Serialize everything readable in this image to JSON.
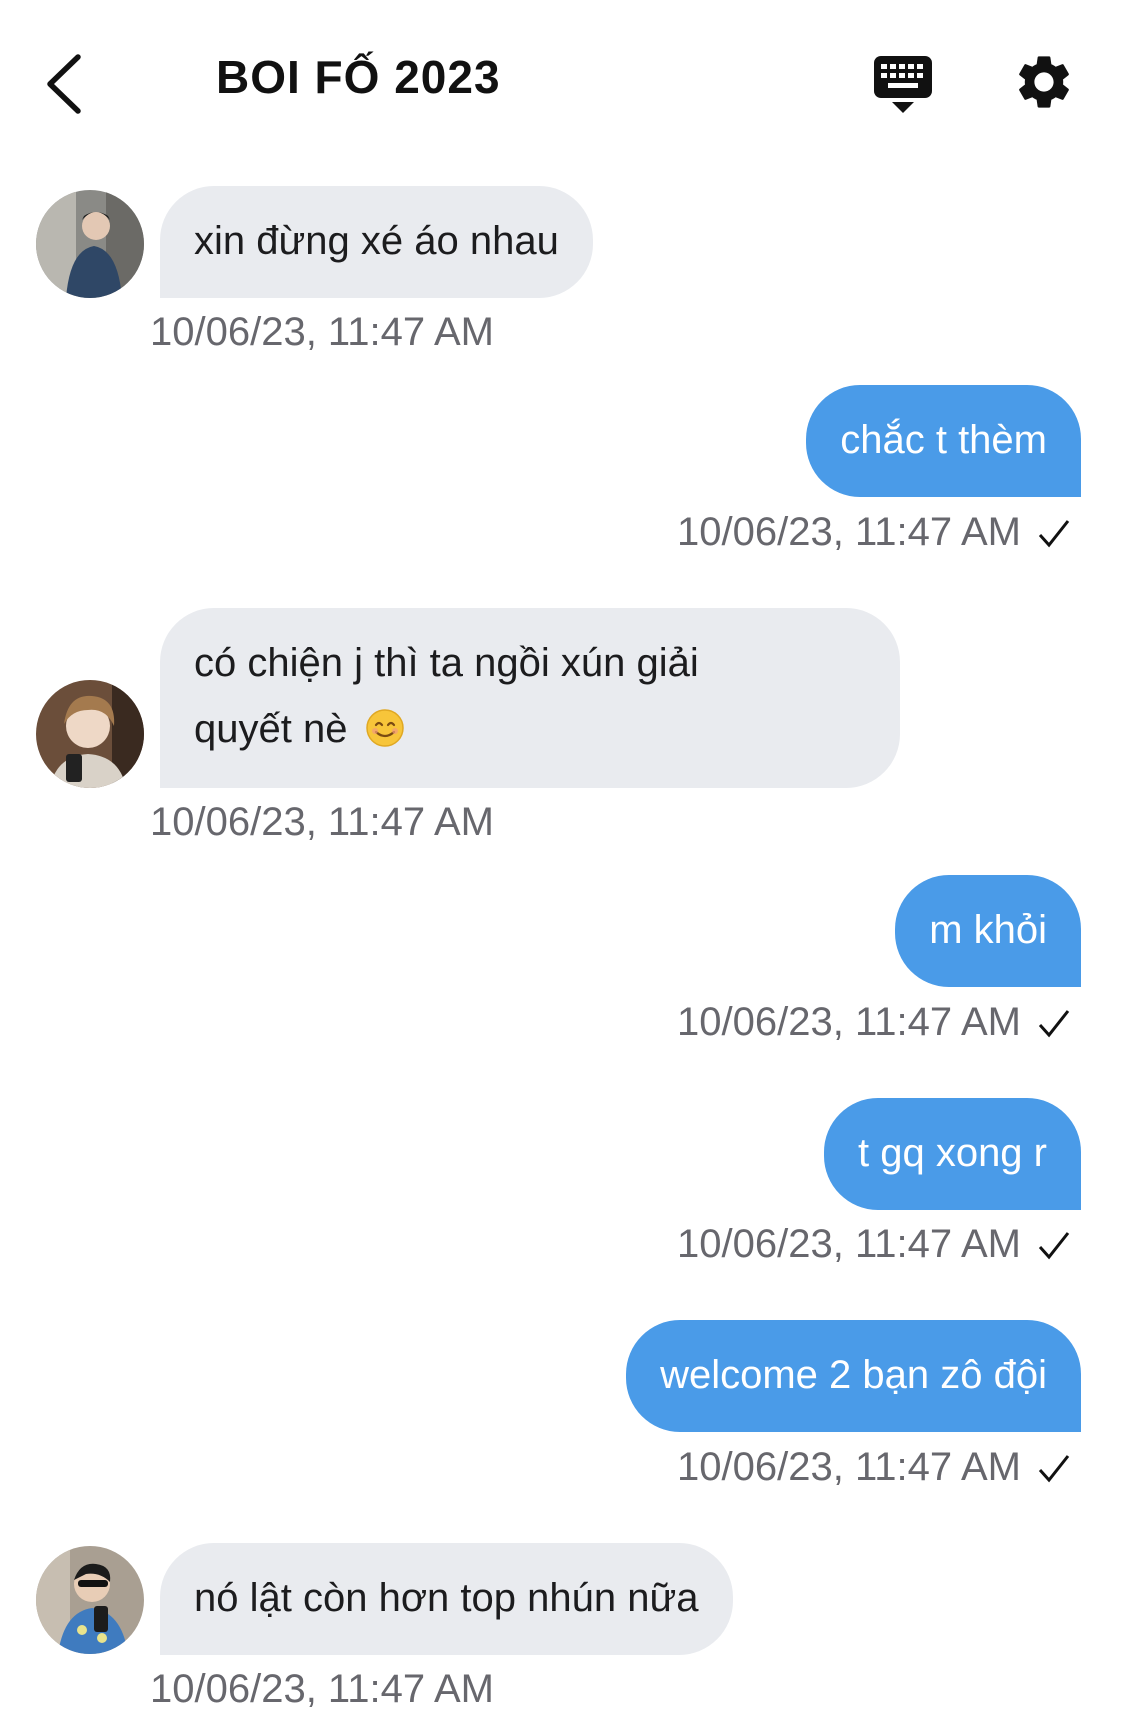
{
  "header": {
    "title": "BOI FỐ 2023",
    "back_icon": "chevron-left-icon",
    "keyboard_icon": "keyboard-icon",
    "settings_icon": "gear-icon"
  },
  "colors": {
    "outgoing_bubble": "#4a9be8",
    "incoming_bubble": "#e9ebef",
    "timestamp": "#67676d"
  },
  "messages": [
    {
      "direction": "in",
      "text": "xin đừng xé áo nhau",
      "timestamp": "10/06/23, 11:47 AM"
    },
    {
      "direction": "out",
      "text": "chắc t thèm",
      "timestamp": "10/06/23, 11:47 AM",
      "status": "sent-check-icon"
    },
    {
      "direction": "in",
      "text_line1": "có chiện j thì ta ngồi xún giải",
      "text_line2": "quyết nè",
      "emoji": "smiling-face-emoji",
      "timestamp": "10/06/23, 11:47 AM"
    },
    {
      "direction": "out",
      "text": "m khỏi",
      "timestamp": "10/06/23, 11:47 AM",
      "status": "sent-check-icon"
    },
    {
      "direction": "out",
      "text": "t gq xong r",
      "timestamp": "10/06/23, 11:47 AM",
      "status": "sent-check-icon"
    },
    {
      "direction": "out",
      "text": "welcome 2 bạn zô đội",
      "timestamp": "10/06/23, 11:47 AM",
      "status": "sent-check-icon"
    },
    {
      "direction": "in",
      "text": "nó lật còn hơn top nhún nữa",
      "timestamp": "10/06/23, 11:47 AM"
    }
  ]
}
